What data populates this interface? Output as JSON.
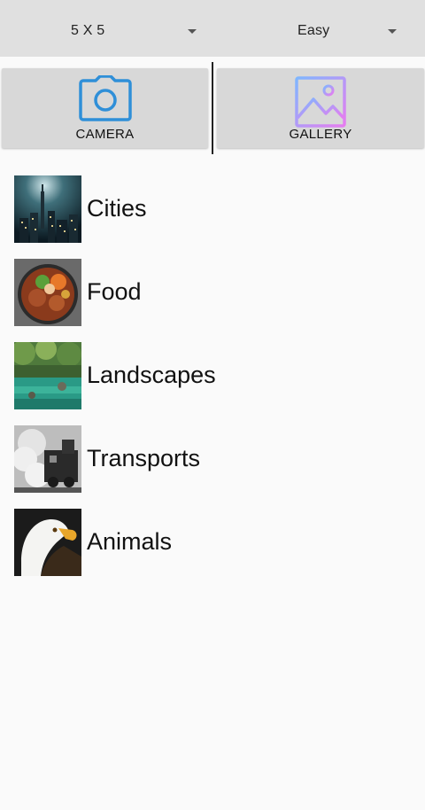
{
  "settings": {
    "grid_size": "5 X 5",
    "difficulty": "Easy"
  },
  "sources": {
    "camera_label": "CAMERA",
    "gallery_label": "GALLERY"
  },
  "categories": [
    {
      "label": "Cities"
    },
    {
      "label": "Food"
    },
    {
      "label": "Landscapes"
    },
    {
      "label": "Transports"
    },
    {
      "label": "Animals"
    }
  ],
  "colors": {
    "camera_icon": "#2f8fd8",
    "gallery_gradient_start": "#7fb6ff",
    "gallery_gradient_end": "#e67cf0"
  }
}
